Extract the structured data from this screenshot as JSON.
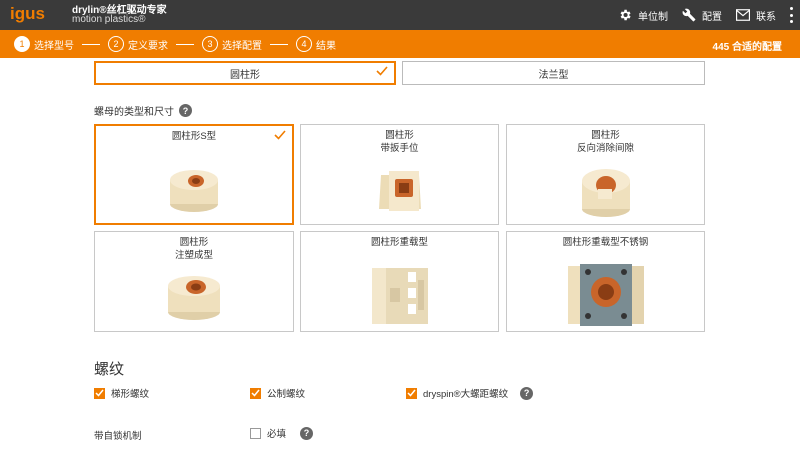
{
  "header": {
    "logo_text": "igus",
    "brand_title": "drylin®丝杠驱动专家",
    "brand_subtitle": "motion plastics®",
    "actions": [
      {
        "label": "单位制",
        "icon": "gear-icon"
      },
      {
        "label": "配置",
        "icon": "wrench-icon"
      },
      {
        "label": "联系",
        "icon": "mail-icon"
      }
    ],
    "menu_icon": "more-vertical-icon"
  },
  "stepbar": {
    "steps": [
      {
        "num": "1",
        "label": "选择型号"
      },
      {
        "num": "2",
        "label": "定义要求"
      },
      {
        "num": "3",
        "label": "选择配置"
      },
      {
        "num": "4",
        "label": "结果"
      }
    ],
    "active_step": 1,
    "result_count": "445 合适的配置"
  },
  "shape": {
    "options": [
      "圆柱形",
      "法兰型"
    ],
    "selected": "圆柱形"
  },
  "nut_section": {
    "label": "螺母的类型和尺寸",
    "cards": [
      {
        "line1": "圆柱形S型",
        "line2": "",
        "selected": true
      },
      {
        "line1": "圆柱形",
        "line2": "带扳手位",
        "selected": false
      },
      {
        "line1": "圆柱形",
        "line2": "反向消除间隙",
        "selected": false
      },
      {
        "line1": "圆柱形",
        "line2": "注塑成型",
        "selected": false
      },
      {
        "line1": "圆柱形重载型",
        "line2": "",
        "selected": false
      },
      {
        "line1": "圆柱形重载型不锈钢",
        "line2": "",
        "selected": false
      }
    ]
  },
  "thread_section": {
    "heading": "螺纹",
    "options": [
      {
        "label": "梯形螺纹",
        "checked": true
      },
      {
        "label": "公制螺纹",
        "checked": true
      },
      {
        "label": "dryspin®大螺距螺纹",
        "checked": true
      }
    ]
  },
  "self_locking": {
    "label": "带自锁机制",
    "option_label": "必填",
    "checked": false
  },
  "colors": {
    "accent": "#f07d00",
    "header_bg": "#3a3a3a"
  }
}
